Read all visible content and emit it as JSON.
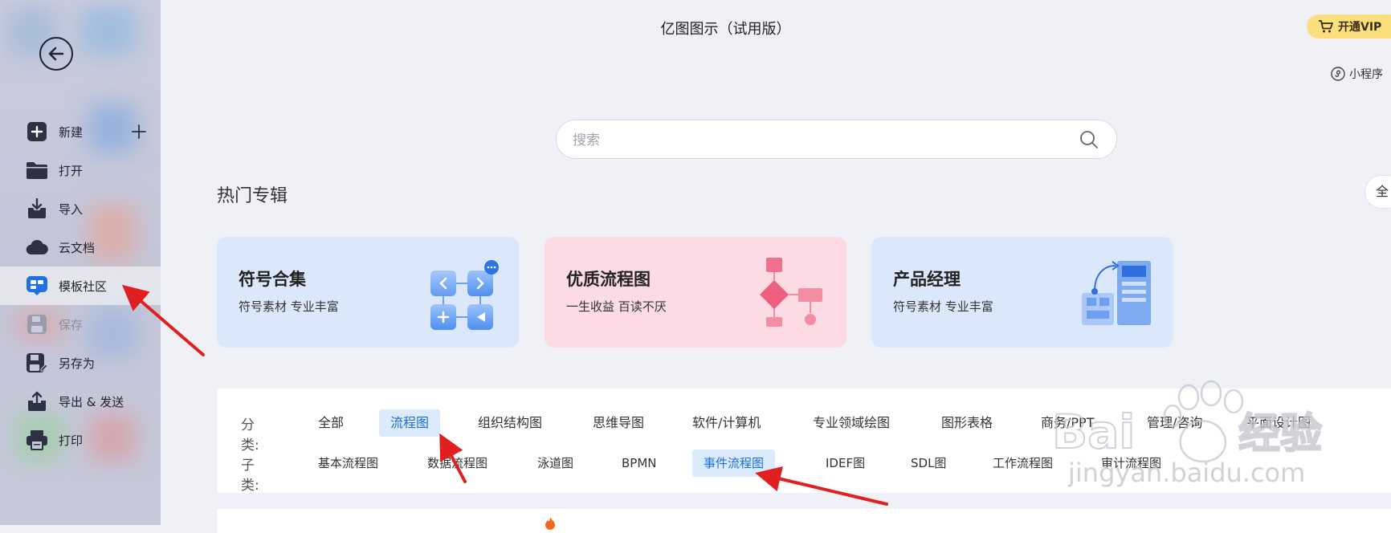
{
  "window": {
    "title": "亿图图示（试用版）"
  },
  "header": {
    "vip_label": "开通VIP",
    "mini_program_label": "小程序"
  },
  "sidebar": {
    "items": [
      {
        "label": "新建"
      },
      {
        "label": "打开"
      },
      {
        "label": "导入"
      },
      {
        "label": "云文档"
      },
      {
        "label": "模板社区"
      },
      {
        "label": "保存"
      },
      {
        "label": "另存为"
      },
      {
        "label": "导出 & 发送"
      },
      {
        "label": "打印"
      }
    ]
  },
  "search": {
    "placeholder": "搜索"
  },
  "section": {
    "title": "热门专辑",
    "all_label": "全"
  },
  "cards": [
    {
      "title": "符号合集",
      "subtitle": "符号素材 专业丰富"
    },
    {
      "title": "优质流程图",
      "subtitle": "一生收益 百读不厌"
    },
    {
      "title": "产品经理",
      "subtitle": "符号素材 专业丰富"
    }
  ],
  "categories": {
    "label": "分类:",
    "items": [
      "全部",
      "流程图",
      "组织结构图",
      "思维导图",
      "软件/计算机",
      "专业领域绘图",
      "图形表格",
      "商务/PPT",
      "管理/咨询",
      "平面设计图"
    ],
    "selected": "流程图"
  },
  "subcategories": {
    "label": "子类:",
    "items": [
      "基本流程图",
      "数据流程图",
      "泳道图",
      "BPMN",
      "事件流程图",
      "IDEF图",
      "SDL图",
      "工作流程图",
      "审计流程图"
    ],
    "selected": "事件流程图"
  },
  "watermark": {
    "brand": "Bai",
    "brand_cn": "经验",
    "url": "jingyan.baidu.com"
  },
  "colors": {
    "accent": "#1b6fd8",
    "vip": "#fcdf7d",
    "arrow": "#e02020",
    "selected_bg": "#dbeafc"
  }
}
